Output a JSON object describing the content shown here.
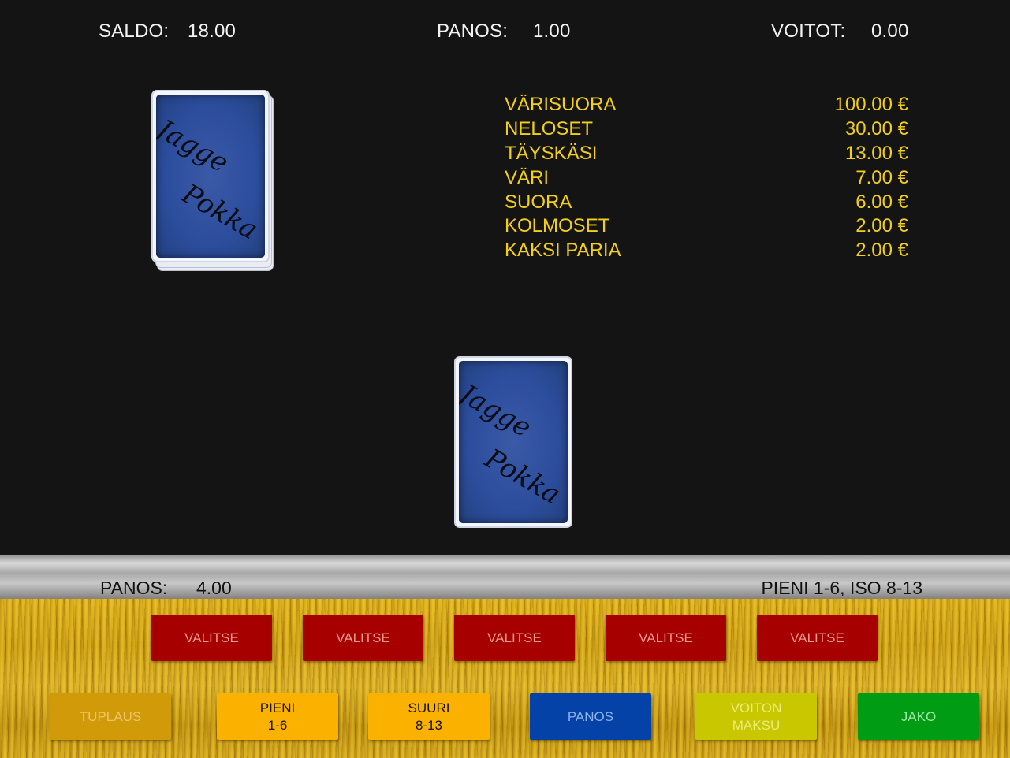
{
  "top_bar": {
    "saldo_label": "SALDO:",
    "saldo_value": "18.00",
    "panos_label": "PANOS:",
    "panos_value": "1.00",
    "voitot_label": "VOITOT:",
    "voitot_value": "0.00"
  },
  "cards": {
    "deck_text_1": "Jagge",
    "deck_text_2": "Pokka",
    "card_text_1": "Jagge",
    "card_text_2": "Pokka"
  },
  "paytable": [
    {
      "hand": "VÄRISUORA",
      "payout": "100.00 €"
    },
    {
      "hand": "NELOSET",
      "payout": "30.00 €"
    },
    {
      "hand": "TÄYSKÄSI",
      "payout": "13.00 €"
    },
    {
      "hand": "VÄRI",
      "payout": "7.00 €"
    },
    {
      "hand": "SUORA",
      "payout": "6.00 €"
    },
    {
      "hand": "KOLMOSET",
      "payout": "2.00 €"
    },
    {
      "hand": "KAKSI PARIA",
      "payout": "2.00 €"
    }
  ],
  "info_bar": {
    "panos_label": "PANOS:",
    "panos_value": "4.00",
    "hint": "PIENI 1-6, ISO 8-13"
  },
  "select_buttons": [
    "VALITSE",
    "VALITSE",
    "VALITSE",
    "VALITSE",
    "VALITSE"
  ],
  "action_buttons": {
    "tuplaus": "TUPLAUS",
    "pieni": "PIENI\n1-6",
    "suuri": "SUURI\n8-13",
    "panos": "PANOS",
    "voiton_maksu": "VOITON\nMAKSU",
    "jako": "JAKO"
  },
  "colors": {
    "paytable_text": "#f2cf18",
    "valitse_bg": "#a60000",
    "tuplaus_bg": "#d19a08",
    "pieni_suuri_bg": "#fbb100",
    "panos_bg": "#0442a8",
    "voiton_maksu_bg": "#c9c800",
    "jako_bg": "#009c14"
  }
}
